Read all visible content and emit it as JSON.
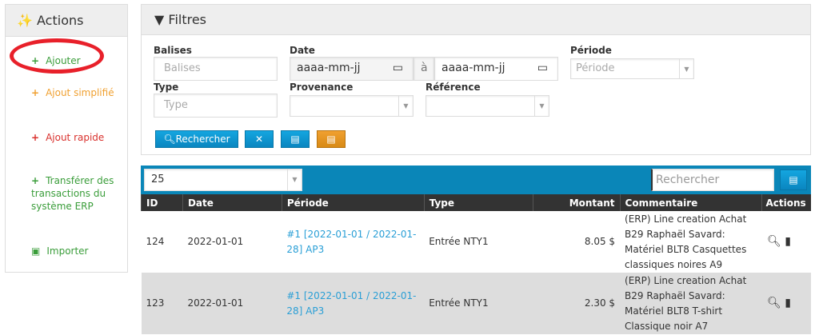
{
  "sidebar": {
    "title": "Actions",
    "icon": "magic-wand-icon",
    "items": [
      {
        "label": "Ajouter",
        "color": "#3a9d3a",
        "icon": "plus-icon"
      },
      {
        "label": "Ajout simplifié",
        "color": "#f0a030",
        "icon": "plus-icon"
      },
      {
        "label": "Ajout rapide",
        "color": "#d9302c",
        "icon": "plus-icon"
      },
      {
        "label": "Transférer des transactions du système ERP",
        "color": "#3a9d3a",
        "icon": "plus-icon"
      },
      {
        "label": "Importer",
        "color": "#3a9d3a",
        "icon": "file-import-icon"
      }
    ]
  },
  "filters": {
    "title": "Filtres",
    "balises_label": "Balises",
    "balises_placeholder": "Balises",
    "date_label": "Date",
    "date_from": "aaaa-mm-jj",
    "date_sep": "à",
    "date_to": "aaaa-mm-jj",
    "periode_label": "Période",
    "periode_placeholder": "Période",
    "type_label": "Type",
    "type_placeholder": "Type",
    "provenance_label": "Provenance",
    "reference_label": "Référence",
    "search_button": "Rechercher"
  },
  "table": {
    "page_size": "25",
    "search_placeholder": "Rechercher",
    "columns": [
      "ID",
      "Date",
      "Période",
      "Type",
      "Montant",
      "Commentaire",
      "Actions"
    ],
    "rows": [
      {
        "id": "124",
        "date": "2022-01-01",
        "periode": "#1 [2022-01-01 / 2022-01-28] AP3",
        "type": "Entrée NTY1",
        "montant": "8.05 $",
        "commentaire": "(ERP) Line creation Achat B29 Raphaël Savard: Matériel BLT8 Casquettes classiques noires A9"
      },
      {
        "id": "123",
        "date": "2022-01-01",
        "periode": "#1 [2022-01-01 / 2022-01-28] AP3",
        "type": "Entrée NTY1",
        "montant": "2.30 $",
        "commentaire": "(ERP) Line creation Achat B29 Raphaël Savard: Matériel BLT8 T-shirt Classique noir A7"
      }
    ]
  }
}
